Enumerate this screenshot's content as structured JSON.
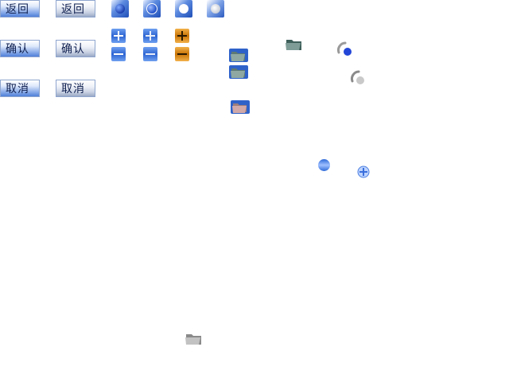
{
  "buttons": {
    "back_label": "返回",
    "confirm_label": "确认",
    "cancel_label": "取消"
  },
  "icons": {
    "radio": "radio-button-icon",
    "plus": "plus-icon",
    "minus": "minus-icon",
    "folder": "folder-icon",
    "spinner": "spinner-icon"
  },
  "colors": {
    "accent_blue": "#2d64d2",
    "orange": "#c87406",
    "silver": "#c7d0e2"
  }
}
